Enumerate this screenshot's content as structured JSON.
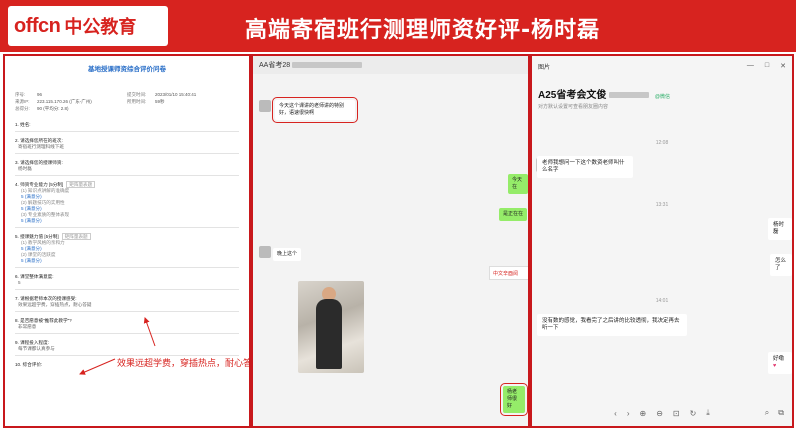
{
  "banner": {
    "logo_latin": "offcn",
    "logo_cn": "中公教育",
    "title": "高端寄宿班行测理师资好评-杨时磊"
  },
  "questionnaire": {
    "title": "基地授课师资综合评价问卷",
    "meta": [
      {
        "k1": "序号:",
        "v1": "96",
        "k2": "提交时间:",
        "v2": "2023/01/10 15:40:41"
      },
      {
        "k1": "来源IP:",
        "v1": "223.115.170.26 (广东-广州)",
        "k2": "所用时间:",
        "v2": "59秒"
      },
      {
        "k1": "总得分:",
        "v1": "90 (平均分: 2.8)",
        "k2": "",
        "v2": ""
      }
    ],
    "items": [
      {
        "q": "1. 姓名:",
        "a": ""
      },
      {
        "q": "2. 请选择您所在的班次:",
        "a": "寄宿班行测理科线下班"
      },
      {
        "q": "3. 请选择您的授课师资:",
        "a": "杨时磊"
      },
      {
        "q": "4. 师资专业能力 [5分制]",
        "tag": "矩阵量表题",
        "subs": [
          "(1) 知识点讲解的准确度",
          "(2) 解题技巧的实用性",
          "(3) 专业素质的整体表现"
        ],
        "score": "5 (满意分)"
      },
      {
        "q": "5. 授课魅力值 [5分制]",
        "tag": "矩阵量表题",
        "subs": [
          "(1) 教学风格的亲和力",
          "(2) 课堂的活跃度"
        ],
        "score": "5 (满意分)"
      },
      {
        "q": "6. 课堂整体满意度:",
        "a": "5"
      },
      {
        "q": "7. 请根据老师本次的授课感受:",
        "a": "效果远超学费，穿插热点，耐心答疑"
      },
      {
        "q": "8. 是否愿意被“推荐此教学”?",
        "a": "非常愿意"
      },
      {
        "q": "9. 课程投入程度:",
        "a": "每节课都认真参与"
      },
      {
        "q": "10. 综合评价:",
        "a": ""
      }
    ],
    "annotation": "效果远超学费，穿插热点，耐心答疑"
  },
  "group_chat": {
    "title_prefix": "AA省考28",
    "messages": [
      {
        "side": "left",
        "text": "今天这个课讲的老师讲的特别好，语速很快啊",
        "highlight": true
      },
      {
        "side": "right",
        "text": "今天在"
      },
      {
        "side": "right",
        "text": "是正在在"
      },
      {
        "side": "left",
        "text": "晚上这个"
      },
      {
        "side": "right",
        "text": "杨老师很好",
        "highlight": true
      }
    ],
    "sticker_text": "中文辛酉阅"
  },
  "wechat": {
    "window_title": "图片",
    "contact_name": "A25省考会文俊",
    "contact_tag": "@微信",
    "contact_sub": "对方默认设置可查看朋友圈内容",
    "times": [
      "12:08",
      "13:31",
      "14:01"
    ],
    "messages": [
      {
        "side": "left",
        "text": "老师我想问一下这个数资老师叫什么名字"
      },
      {
        "side": "right",
        "text": "杨时磊"
      },
      {
        "side": "right",
        "text": "怎么了"
      },
      {
        "side": "left",
        "text": "没有数的感觉，我看完了之后讲的比较透彻，我决定再去听一下"
      },
      {
        "side": "right",
        "text": "好嘞"
      }
    ],
    "controls": [
      "—",
      "□",
      "✕"
    ],
    "toolbar": [
      "‹",
      "›",
      "⊕",
      "⊖",
      "⊡",
      "↻",
      "⤓"
    ],
    "toolbar_right": [
      "⌕",
      "⧉"
    ]
  }
}
